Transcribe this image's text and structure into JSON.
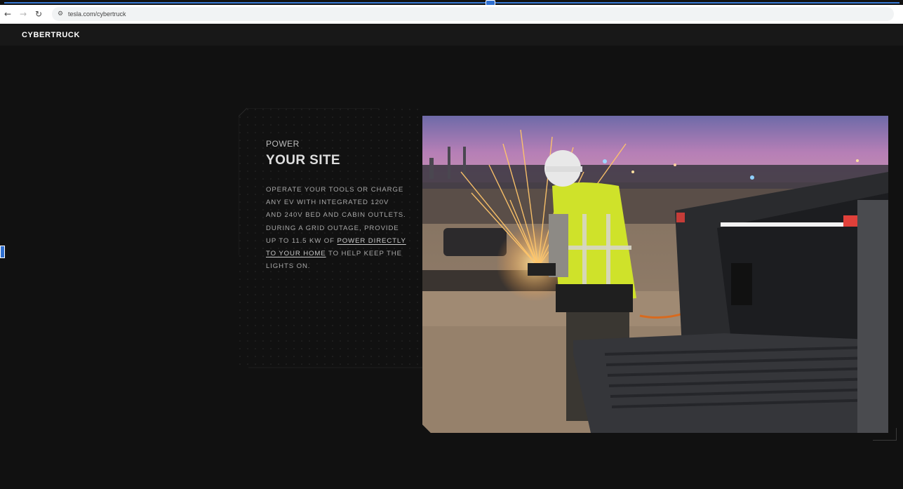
{
  "browser": {
    "url": "tesla.com/cybertruck",
    "back_icon": "arrow-left-icon",
    "forward_icon": "arrow-right-icon",
    "reload_icon": "reload-icon",
    "site_settings_icon": "tune-icon"
  },
  "header": {
    "brand": "CYBERTRUCK"
  },
  "feature": {
    "eyebrow": "POWER",
    "headline": "YOUR SITE",
    "body_before_link": "OPERATE YOUR TOOLS OR CHARGE ANY EV WITH INTEGRATED 120V AND 240V BED AND CABIN OUTLETS. DURING A GRID OUTAGE, PROVIDE UP TO 11.5 KW OF ",
    "link_text": "POWER DIRECTLY TO YOUR HOME",
    "body_after_link": " TO HELP KEEP THE LIGHTS ON."
  },
  "colors": {
    "page_bg": "#111111",
    "header_bg": "#181818",
    "selection_accent": "#3a7bd5",
    "safety_vest": "#d4e82a",
    "tail_light": "#e0403a"
  }
}
